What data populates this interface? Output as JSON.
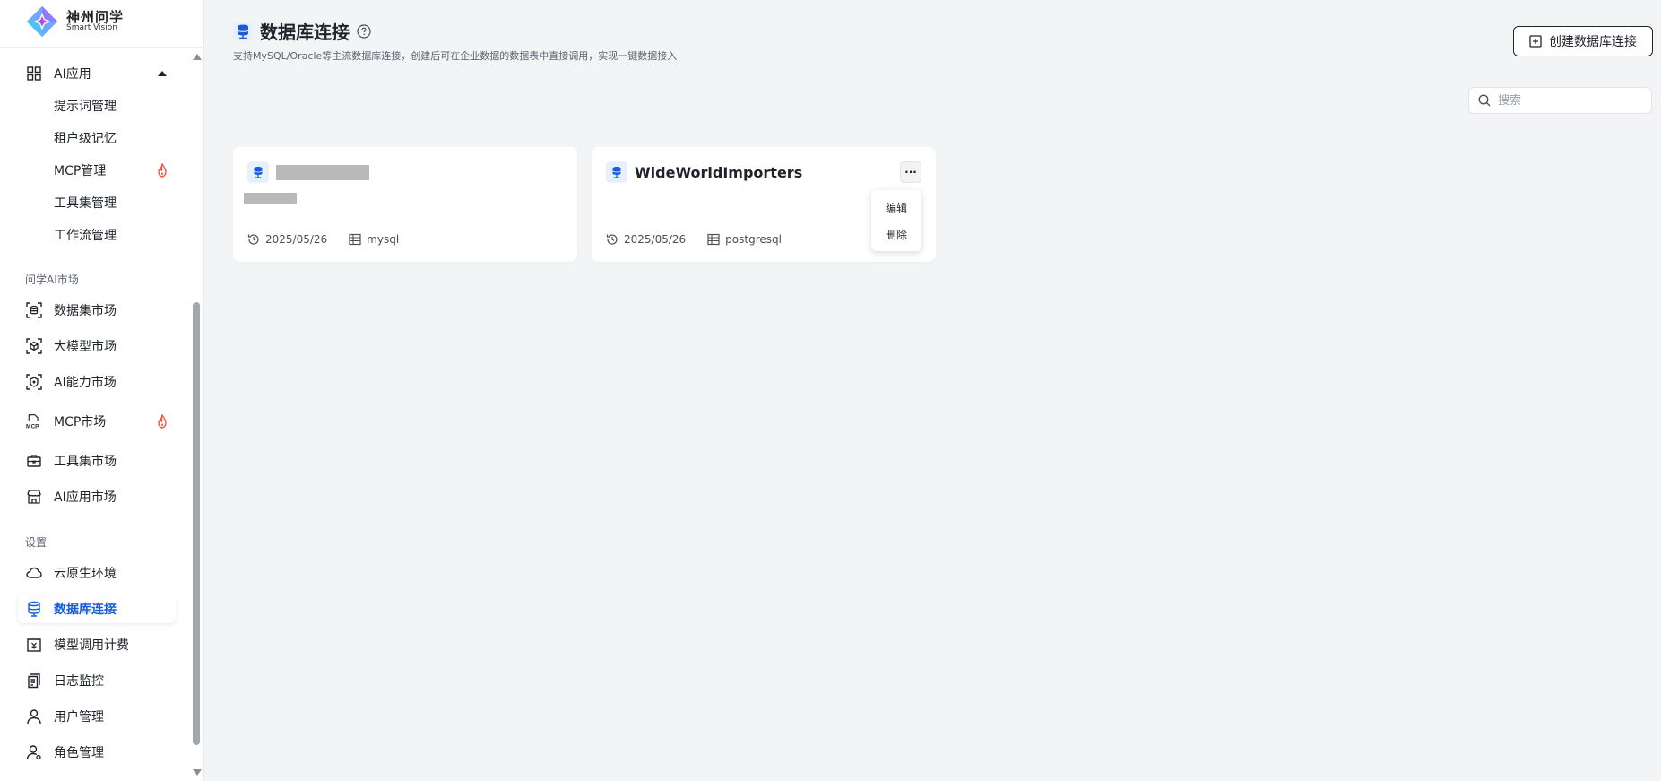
{
  "brand": {
    "name_cn": "神州问学",
    "name_en": "Smart Vision"
  },
  "sidebar": {
    "ai_app": {
      "label": "AI应用",
      "subitems": [
        {
          "label": "提示词管理",
          "hot": false
        },
        {
          "label": "租户级记忆",
          "hot": false
        },
        {
          "label": "MCP管理",
          "hot": true
        },
        {
          "label": "工具集管理",
          "hot": false
        },
        {
          "label": "工作流管理",
          "hot": false
        }
      ]
    },
    "market_section": "问学AI市场",
    "market_items": [
      {
        "label": "数据集市场",
        "icon": "dataset-icon",
        "hot": false
      },
      {
        "label": "大模型市场",
        "icon": "model-cube-icon",
        "hot": false
      },
      {
        "label": "AI能力市场",
        "icon": "ai-ability-icon",
        "hot": false
      },
      {
        "label": "MCP市场",
        "icon": "mcp-icon",
        "hot": true
      },
      {
        "label": "工具集市场",
        "icon": "toolbox-icon",
        "hot": false
      },
      {
        "label": "AI应用市场",
        "icon": "store-icon",
        "hot": false
      }
    ],
    "settings_section": "设置",
    "settings_items": [
      {
        "label": "云原生环境",
        "icon": "cloud-icon"
      },
      {
        "label": "数据库连接",
        "icon": "database-icon",
        "active": true
      },
      {
        "label": "模型调用计费",
        "icon": "billing-icon"
      },
      {
        "label": "日志监控",
        "icon": "log-icon"
      },
      {
        "label": "用户管理",
        "icon": "user-icon"
      },
      {
        "label": "角色管理",
        "icon": "role-icon"
      }
    ]
  },
  "page": {
    "title": "数据库连接",
    "subtitle": "支持MySQL/Oracle等主流数据库连接，创建后可在企业数据的数据表中直接调用，实现一键数据接入",
    "create_button": "创建数据库连接",
    "search_placeholder": "搜索"
  },
  "cards": [
    {
      "name": "",
      "description": "",
      "date": "2025/05/26",
      "db_type": "mysql"
    },
    {
      "name": "WideWorldImporters",
      "description": "",
      "date": "2025/05/26",
      "db_type": "postgresql",
      "menu": {
        "edit": "编辑",
        "delete": "删除"
      }
    }
  ],
  "colors": {
    "accent": "#1a5bd9",
    "fire": "#f5533d",
    "background": "#f3f4f6"
  }
}
